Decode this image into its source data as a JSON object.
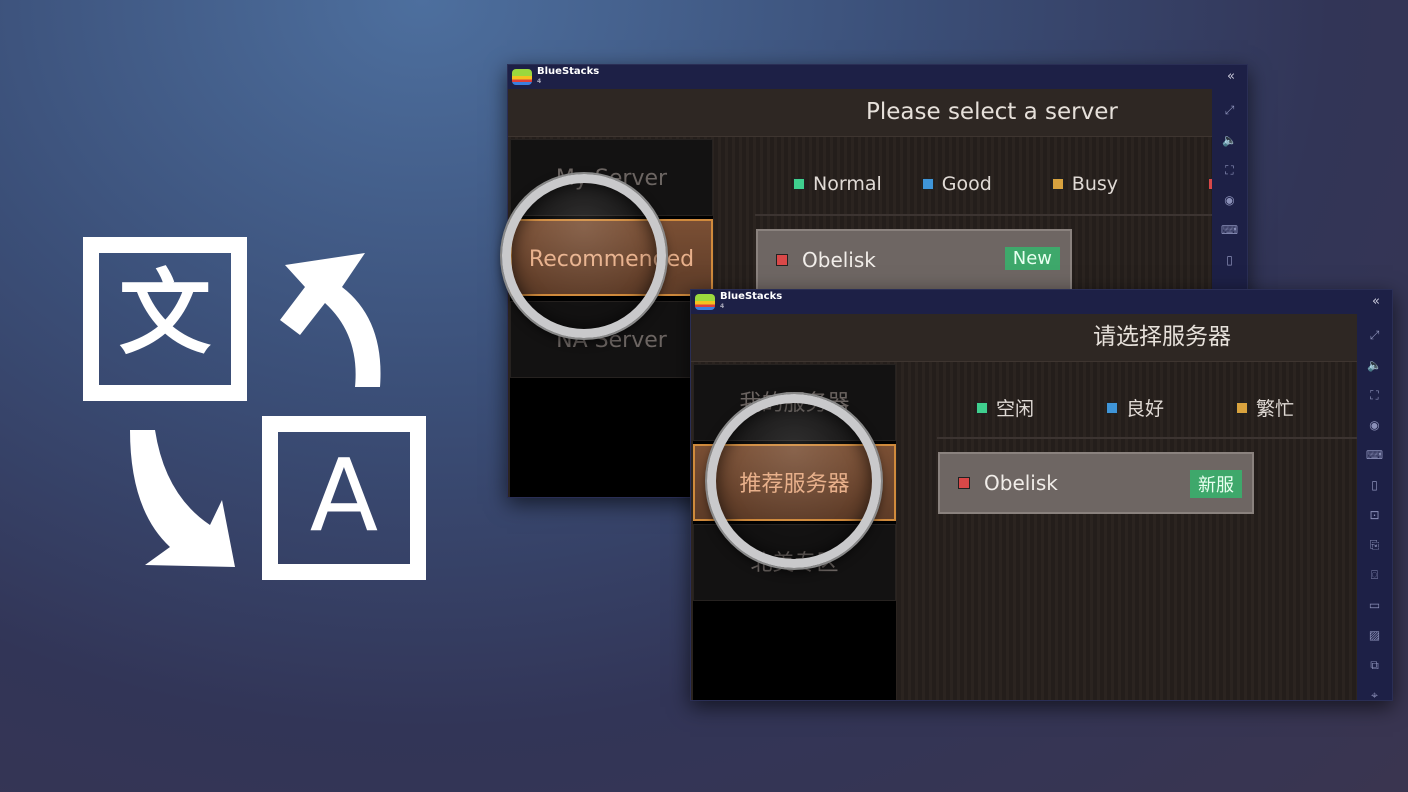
{
  "icon": {
    "name": "translate-icon",
    "source_char": "文",
    "target_char": "A"
  },
  "window_en": {
    "app": "BlueStacks",
    "version": "4",
    "header": "Please select a server",
    "servers": [
      {
        "label": "My Server"
      },
      {
        "label": "Recommended",
        "selected": true
      },
      {
        "label": "NA Server"
      }
    ],
    "legend": [
      {
        "label": "Normal",
        "color": "#3fcf8e"
      },
      {
        "label": "Good",
        "color": "#3f95d8"
      },
      {
        "label": "Busy",
        "color": "#d8a23e"
      },
      {
        "label": "",
        "color": "#d84848"
      }
    ],
    "card": {
      "name": "Obelisk",
      "status_color": "#d84848",
      "badge": "New"
    }
  },
  "window_zh": {
    "app": "BlueStacks",
    "version": "4",
    "header": "请选择服务器",
    "servers": [
      {
        "label": "我的服务器"
      },
      {
        "label": "推荐服务器",
        "selected": true
      },
      {
        "label": "北美专区"
      }
    ],
    "legend": [
      {
        "label": "空闲",
        "color": "#3fcf8e"
      },
      {
        "label": "良好",
        "color": "#3f95d8"
      },
      {
        "label": "繁忙",
        "color": "#d8a23e"
      }
    ],
    "card": {
      "name": "Obelisk",
      "status_color": "#d84848",
      "badge": "新服"
    }
  },
  "sidebar_icons": [
    "fullscreen-icon",
    "volume-icon",
    "screenshot-region-icon",
    "eye-icon",
    "keyboard-icon",
    "phone-icon",
    "gamepad-icon",
    "install-apk-icon",
    "camera-icon",
    "record-icon",
    "media-icon",
    "multi-instance-icon",
    "location-icon"
  ]
}
